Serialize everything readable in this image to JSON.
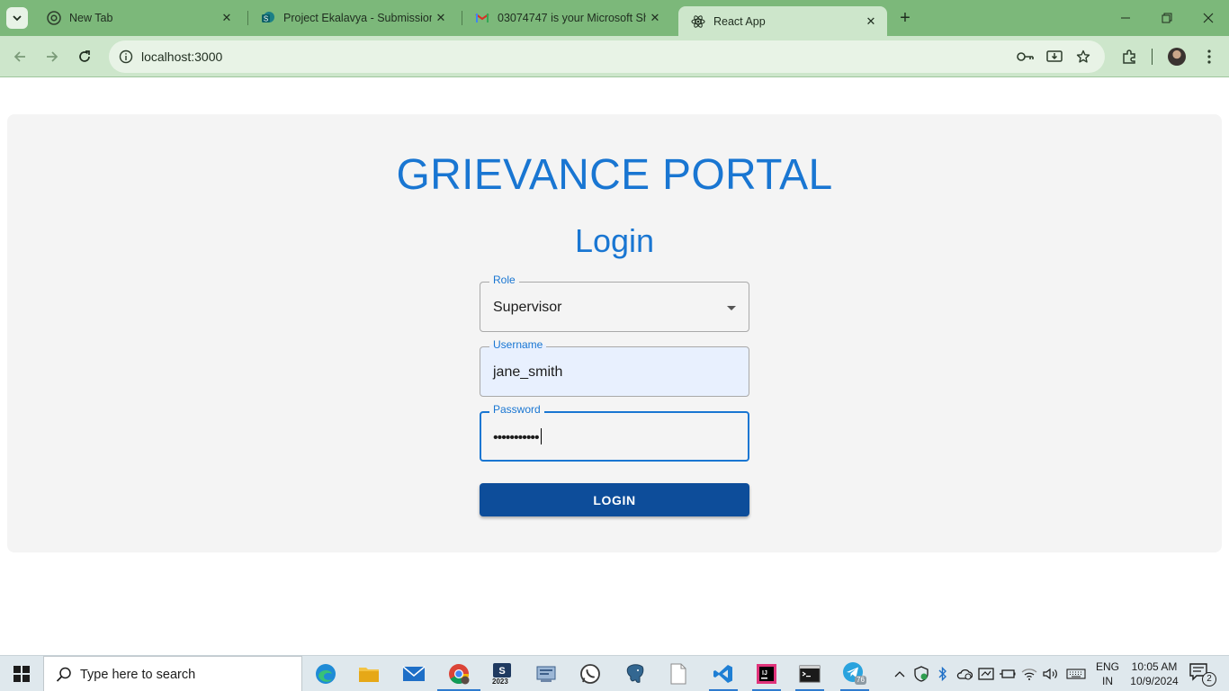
{
  "browser": {
    "tabs": [
      {
        "title": "New Tab",
        "icon": "chrome-icon",
        "active": false
      },
      {
        "title": "Project Ekalavya - Submissions",
        "icon": "sharepoint-icon",
        "active": false
      },
      {
        "title": "03074747 is your Microsoft Sha",
        "icon": "gmail-icon",
        "active": false
      },
      {
        "title": "React App",
        "icon": "react-icon",
        "active": true
      }
    ],
    "address": "localhost:3000",
    "colors": {
      "frame": "#7cb87a",
      "toolbar": "#cde6cb"
    }
  },
  "page": {
    "title": "GRIEVANCE PORTAL",
    "heading": "Login",
    "role": {
      "label": "Role",
      "value": "Supervisor"
    },
    "username": {
      "label": "Username",
      "value": "jane_smith"
    },
    "password": {
      "label": "Password",
      "value": "•••••••••••"
    },
    "login_button": "LOGIN",
    "colors": {
      "accent": "#1976d2",
      "button": "#0d4d9a",
      "card": "#f4f4f4",
      "autofill": "#e8f0fe"
    }
  },
  "taskbar": {
    "search_placeholder": "Type here to search",
    "apps": [
      "edge-icon",
      "file-explorer-icon",
      "mail-icon",
      "chrome-icon",
      "sql-server-2023-icon",
      "network-app-icon",
      "whatsapp-icon",
      "postgresql-icon",
      "notepad-icon",
      "vscode-icon",
      "intellij-icon",
      "terminal-icon",
      "telegram-icon"
    ],
    "sql_badge": "2023",
    "telegram_badge": "76",
    "language": {
      "line1": "ENG",
      "line2": "IN"
    },
    "time": "10:05 AM",
    "date": "10/9/2024",
    "notification_count": "2"
  }
}
